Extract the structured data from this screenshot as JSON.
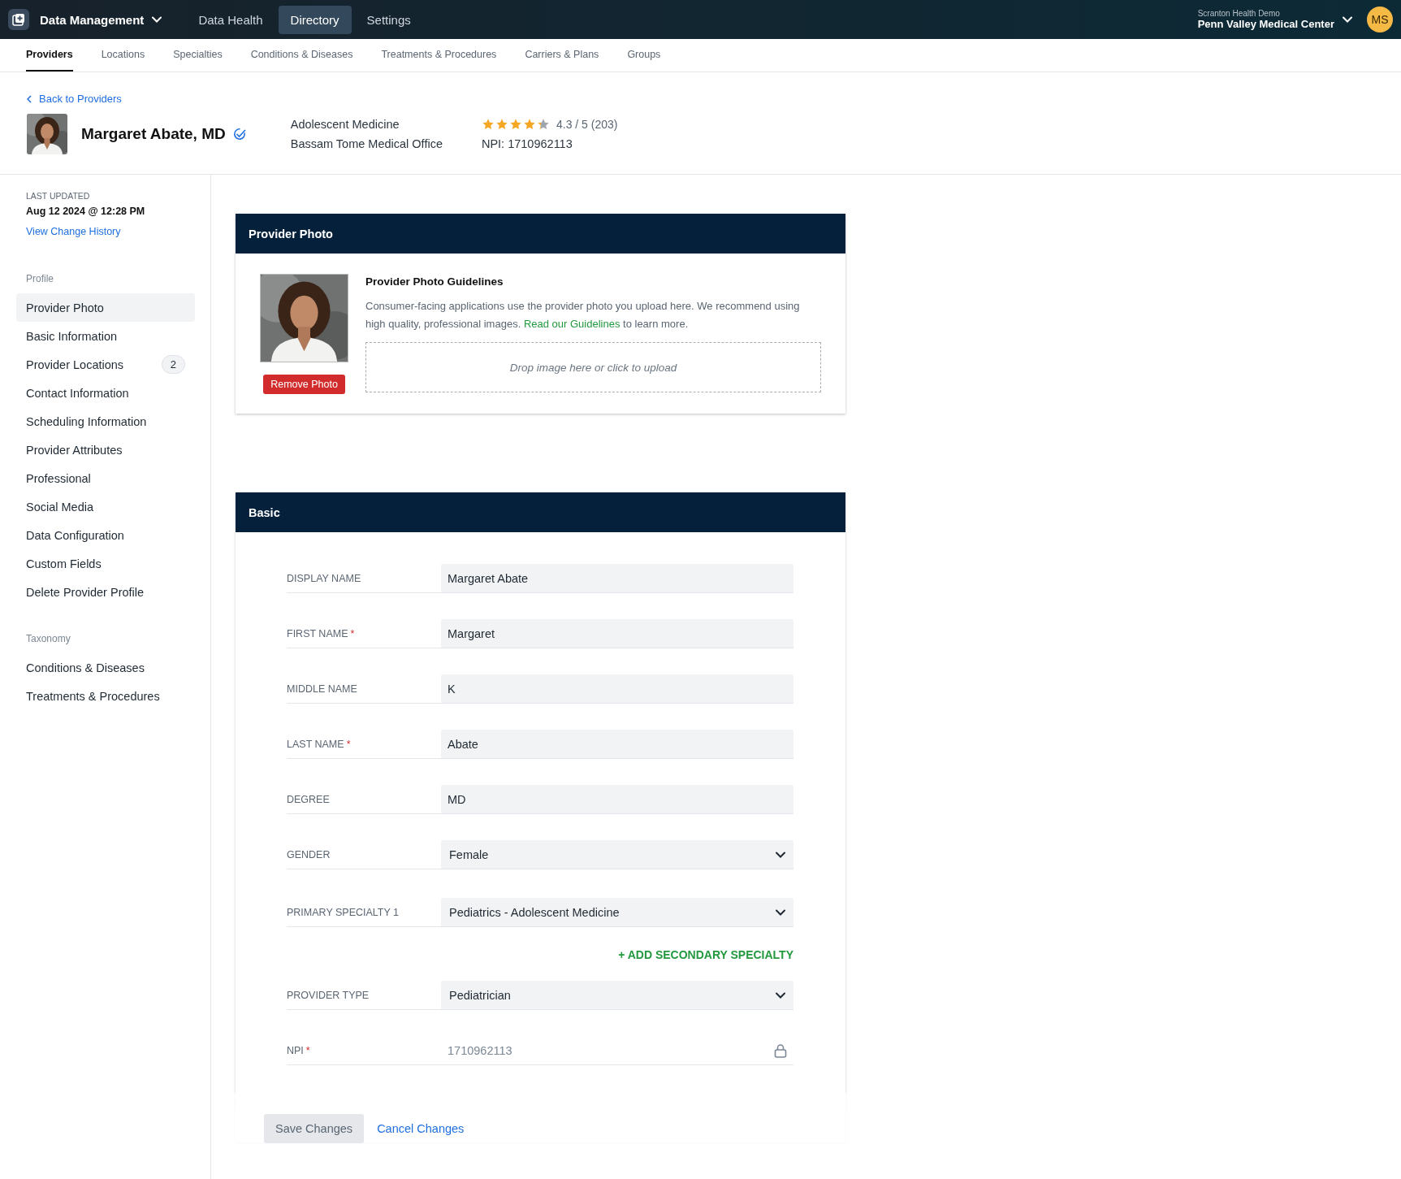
{
  "topbar": {
    "app_name": "Data Management",
    "nav": [
      {
        "label": "Data Health",
        "selected": false
      },
      {
        "label": "Directory",
        "selected": true
      },
      {
        "label": "Settings",
        "selected": false
      }
    ],
    "org_caption": "Scranton Health Demo",
    "org_name": "Penn Valley Medical Center",
    "avatar": "MS"
  },
  "tabs": [
    {
      "label": "Providers",
      "selected": true
    },
    {
      "label": "Locations",
      "selected": false
    },
    {
      "label": "Specialties",
      "selected": false
    },
    {
      "label": "Conditions & Diseases",
      "selected": false
    },
    {
      "label": "Treatments & Procedures",
      "selected": false
    },
    {
      "label": "Carriers & Plans",
      "selected": false
    },
    {
      "label": "Groups",
      "selected": false
    }
  ],
  "back_link": "Back to Providers",
  "provider": {
    "name": "Margaret Abate, MD",
    "verified": true,
    "specialty": "Adolescent Medicine",
    "office": "Bassam Tome Medical Office",
    "stars": 4.3,
    "rating": "4.3 / 5 (203)",
    "npi": "NPI: 1710962113"
  },
  "sidebar": {
    "updated_label": "LAST UPDATED",
    "updated_value": "Aug 12 2024 @ 12:28 PM",
    "history_link": "View Change History",
    "sections": [
      {
        "title": "Profile",
        "items": [
          {
            "label": "Provider Photo",
            "selected": true
          },
          {
            "label": "Basic Information",
            "selected": false
          },
          {
            "label": "Provider Locations",
            "selected": false,
            "count": "2"
          },
          {
            "label": "Contact Information",
            "selected": false
          },
          {
            "label": "Scheduling Information",
            "selected": false
          },
          {
            "label": "Provider Attributes",
            "selected": false
          },
          {
            "label": "Professional",
            "selected": false
          },
          {
            "label": "Social Media",
            "selected": false
          },
          {
            "label": "Data Configuration",
            "selected": false
          },
          {
            "label": "Custom Fields",
            "selected": false
          },
          {
            "label": "Delete Provider Profile",
            "selected": false
          }
        ]
      },
      {
        "title": "Taxonomy",
        "items": [
          {
            "label": "Conditions & Diseases",
            "selected": false
          },
          {
            "label": "Treatments & Procedures",
            "selected": false
          }
        ]
      }
    ]
  },
  "photo_card": {
    "title": "Provider Photo",
    "remove_button": "Remove Photo",
    "guidelines_title": "Provider Photo Guidelines",
    "guidelines_text": "Consumer-facing applications use the provider photo you upload here. We recommend using high quality, professional images.",
    "guidelines_link": "Read our Guidelines",
    "guidelines_tail": "to learn more.",
    "dropzone": "Drop image here or click to upload"
  },
  "basic_card": {
    "title": "Basic",
    "fields": [
      {
        "kind": "text",
        "label": "DISPLAY NAME",
        "required": false,
        "value": "Margaret Abate"
      },
      {
        "kind": "text",
        "label": "FIRST NAME",
        "required": true,
        "value": "Margaret"
      },
      {
        "kind": "text",
        "label": "MIDDLE NAME",
        "required": false,
        "value": "K"
      },
      {
        "kind": "text",
        "label": "LAST NAME",
        "required": true,
        "value": "Abate"
      },
      {
        "kind": "text",
        "label": "DEGREE",
        "required": false,
        "value": "MD"
      },
      {
        "kind": "select",
        "label": "GENDER",
        "required": false,
        "value": "Female"
      },
      {
        "kind": "specialty",
        "label": "PRIMARY SPECIALTY 1",
        "required": false,
        "value": "Pediatrics - Adolescent Medicine"
      },
      {
        "kind": "link",
        "value": "+ ADD SECONDARY SPECIALTY"
      },
      {
        "kind": "select",
        "label": "PROVIDER TYPE",
        "required": false,
        "value": "Pediatrician"
      },
      {
        "kind": "locked",
        "label": "NPI",
        "required": true,
        "value": "1710962113"
      }
    ],
    "required_mark": "*"
  },
  "footer": {
    "save": "Save Changes",
    "save_disabled": true,
    "cancel": "Cancel Changes"
  }
}
